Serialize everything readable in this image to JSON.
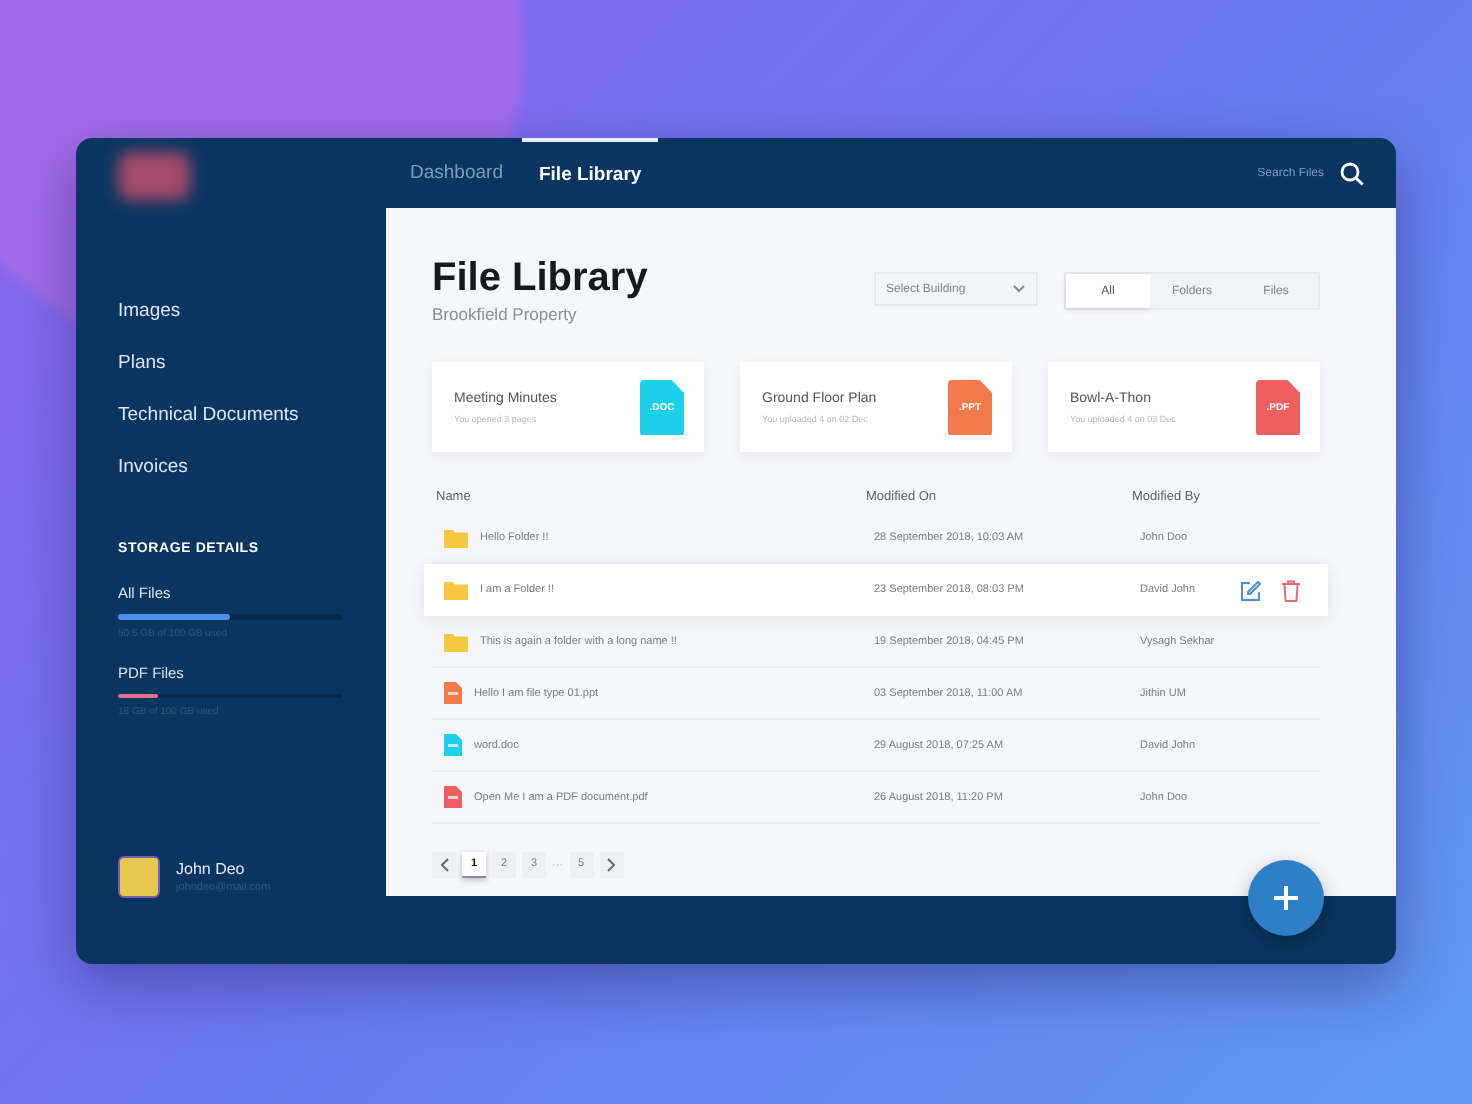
{
  "nav": {
    "tabs": [
      {
        "label": "Dashboard",
        "selected": false
      },
      {
        "label": "File Library",
        "selected": true
      }
    ],
    "search": {
      "placeholder": "Search Files"
    }
  },
  "sidebar": {
    "items": [
      {
        "label": "Images"
      },
      {
        "label": "Plans"
      },
      {
        "label": "Technical Documents"
      },
      {
        "label": "Invoices"
      }
    ],
    "storage": {
      "title": "STORAGE DETAILS",
      "items": [
        {
          "label": "All Files",
          "level": 0.5,
          "color": "#4f8ff0",
          "caption": "50.5 GB of 100 GB used"
        },
        {
          "label": "PDF Files",
          "level": 0.18,
          "color": "#e0708a",
          "caption": "18 GB of 100 GB used"
        }
      ]
    },
    "user": {
      "name": "John Deo",
      "email": "johndeo@mail.com"
    }
  },
  "header": {
    "title": "File Library",
    "subtitle": "Brookfield Property",
    "select": {
      "placeholder": "Select Building"
    },
    "filters": [
      {
        "label": "All",
        "selected": true
      },
      {
        "label": "Folders",
        "selected": false
      },
      {
        "label": "Files",
        "selected": false
      }
    ]
  },
  "recent": [
    {
      "title": "Meeting Minutes",
      "caption": "You opened 3 pages",
      "badge": ".DOC",
      "color": "#1fd0ea"
    },
    {
      "title": "Ground Floor Plan",
      "caption": "You uploaded 4 on 02 Dec",
      "badge": ".PPT",
      "color": "#f27a4b"
    },
    {
      "title": "Bowl-A-Thon",
      "caption": "You uploaded 4 on 03 Dec",
      "badge": ".PDF",
      "color": "#ef5f61"
    }
  ],
  "table": {
    "columns": [
      "Name",
      "Modified On",
      "Modified By"
    ],
    "rows": [
      {
        "kind": "folder",
        "name": "Hello Folder !!",
        "modified_on": "28 September 2018, 10:03 AM",
        "modified_by": "John Doo",
        "selected": false
      },
      {
        "kind": "folder",
        "name": "I am a Folder !!",
        "modified_on": "23 September 2018, 08:03 PM",
        "modified_by": "David John",
        "selected": true
      },
      {
        "kind": "folder",
        "name": "This is again a folder with a long name !!",
        "modified_on": "19 September 2018, 04:45 PM",
        "modified_by": "Vysagh Sekhar",
        "selected": false
      },
      {
        "kind": "ppt",
        "name": "Hello I am file type 01.ppt",
        "modified_on": "03 September 2018, 11:00 AM",
        "modified_by": "Jithin UM",
        "selected": false
      },
      {
        "kind": "doc",
        "name": "word.doc",
        "modified_on": "29 August 2018, 07:25 AM",
        "modified_by": "David John",
        "selected": false
      },
      {
        "kind": "pdf",
        "name": "Open Me I am a PDF document.pdf",
        "modified_on": "26 August 2018, 11:20 PM",
        "modified_by": "John Doo",
        "selected": false
      }
    ]
  },
  "pagination": [
    {
      "kind": "page",
      "label": "1",
      "selected": true
    },
    {
      "kind": "page",
      "label": "2",
      "selected": false
    },
    {
      "kind": "page",
      "label": "3",
      "selected": false
    },
    {
      "kind": "ellipsis",
      "label": "···"
    },
    {
      "kind": "page",
      "label": "5",
      "selected": false
    }
  ]
}
